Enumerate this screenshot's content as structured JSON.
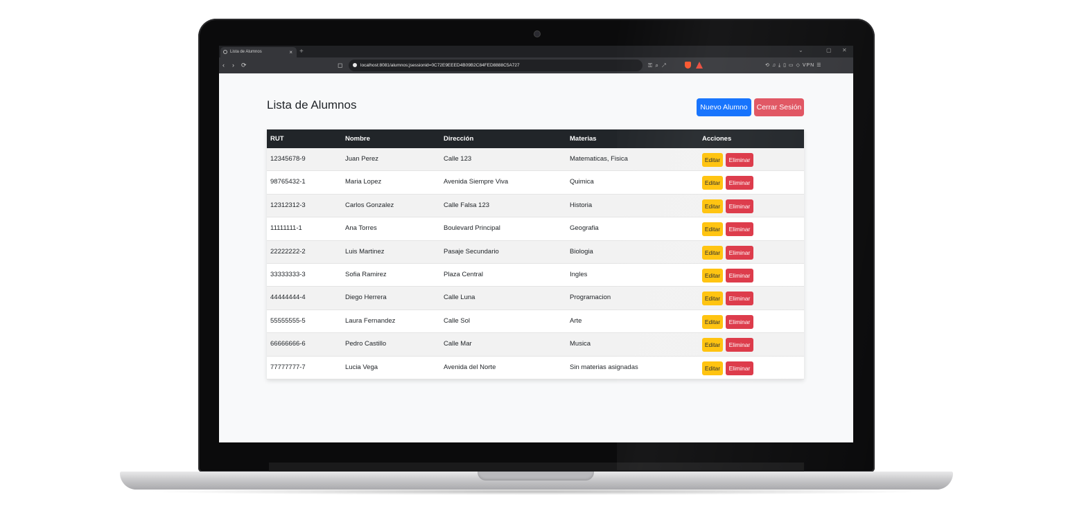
{
  "browser": {
    "tab_title": "Lista de Alumnos",
    "tab_close": "×",
    "new_tab": "+",
    "window_controls": [
      "⌄",
      "▢",
      "✕"
    ],
    "url": "localhost:8081/alumnos;jsessionid=0C72E9EEED4B09B2C84FED8888C5A727",
    "nav_back": "‹",
    "nav_forward": "›",
    "nav_reload": "⟳",
    "bookmark": "◻",
    "vpn_label": "VPN",
    "shield_badge": "brave-shield-icon",
    "rewards_badge": "brave-rewards-icon"
  },
  "page": {
    "title": "Lista de Alumnos",
    "new_button": "Nuevo Alumno",
    "logout_button": "Cerrar Sesión"
  },
  "colors": {
    "primary": "#0d6efd",
    "danger": "#dc3545",
    "warning": "#ffc107",
    "header_dark": "#212529"
  },
  "table": {
    "headers": [
      "RUT",
      "Nombre",
      "Dirección",
      "Materias",
      "Acciones"
    ],
    "edit_label": "Editar",
    "delete_label": "Eliminar",
    "rows": [
      {
        "rut": "12345678-9",
        "nombre": "Juan Perez",
        "direccion": "Calle 123",
        "materias": "Matematicas, Fisica"
      },
      {
        "rut": "98765432-1",
        "nombre": "Maria Lopez",
        "direccion": "Avenida Siempre Viva",
        "materias": "Quimica"
      },
      {
        "rut": "12312312-3",
        "nombre": "Carlos Gonzalez",
        "direccion": "Calle Falsa 123",
        "materias": "Historia"
      },
      {
        "rut": "11111111-1",
        "nombre": "Ana Torres",
        "direccion": "Boulevard Principal",
        "materias": "Geografia"
      },
      {
        "rut": "22222222-2",
        "nombre": "Luis Martinez",
        "direccion": "Pasaje Secundario",
        "materias": "Biologia"
      },
      {
        "rut": "33333333-3",
        "nombre": "Sofia Ramirez",
        "direccion": "Plaza Central",
        "materias": "Ingles"
      },
      {
        "rut": "44444444-4",
        "nombre": "Diego Herrera",
        "direccion": "Calle Luna",
        "materias": "Programacion"
      },
      {
        "rut": "55555555-5",
        "nombre": "Laura Fernandez",
        "direccion": "Calle Sol",
        "materias": "Arte"
      },
      {
        "rut": "66666666-6",
        "nombre": "Pedro Castillo",
        "direccion": "Calle Mar",
        "materias": "Musica"
      },
      {
        "rut": "77777777-7",
        "nombre": "Lucia Vega",
        "direccion": "Avenida del Norte",
        "materias": "Sin materias asignadas"
      }
    ]
  }
}
